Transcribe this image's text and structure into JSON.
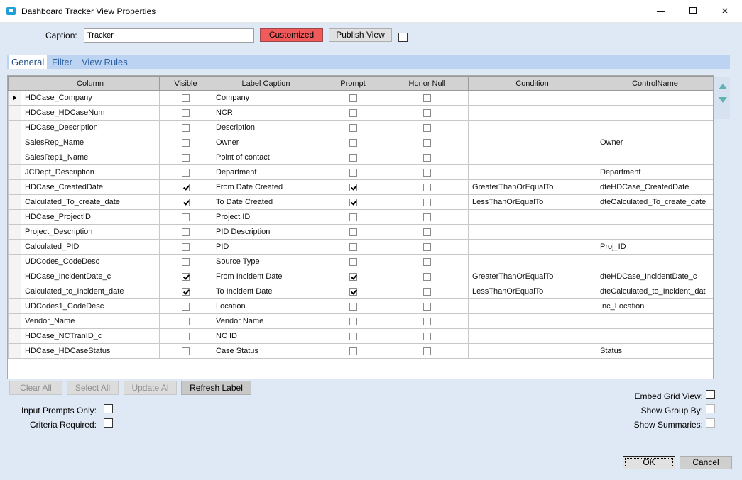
{
  "window": {
    "title": "Dashboard Tracker View Properties",
    "minimize_glyph": "",
    "close_glyph": "✕"
  },
  "caption": {
    "label": "Caption:",
    "value": "Tracker",
    "customized_label": "Customized",
    "publish_label": "Publish View",
    "checkbox_checked": false
  },
  "colors": {
    "customized_bg": "#f05a5a",
    "tab_strip": "#bcd4f2",
    "window_bg": "#dfe8f5",
    "scroll_arrow": "#5fb3b3"
  },
  "tabs": [
    {
      "label": "General",
      "active": true
    },
    {
      "label": "Filter",
      "active": false
    },
    {
      "label": "View Rules",
      "active": false
    }
  ],
  "grid": {
    "columns": [
      "Column",
      "Visible",
      "Label Caption",
      "Prompt",
      "Honor Null",
      "Condition",
      "ControlName"
    ],
    "current_row": 0,
    "rows": [
      {
        "column": "HDCase_Company",
        "visible": false,
        "label": "Company",
        "prompt": false,
        "honor_null": false,
        "condition": "",
        "control": ""
      },
      {
        "column": "HDCase_HDCaseNum",
        "visible": false,
        "label": "NCR",
        "prompt": false,
        "honor_null": false,
        "condition": "",
        "control": ""
      },
      {
        "column": "HDCase_Description",
        "visible": false,
        "label": "Description",
        "prompt": false,
        "honor_null": false,
        "condition": "",
        "control": ""
      },
      {
        "column": "SalesRep_Name",
        "visible": false,
        "label": "Owner",
        "prompt": false,
        "honor_null": false,
        "condition": "",
        "control": "Owner"
      },
      {
        "column": "SalesRep1_Name",
        "visible": false,
        "label": "Point of contact",
        "prompt": false,
        "honor_null": false,
        "condition": "",
        "control": ""
      },
      {
        "column": "JCDept_Description",
        "visible": false,
        "label": "Department",
        "prompt": false,
        "honor_null": false,
        "condition": "",
        "control": "Department"
      },
      {
        "column": "HDCase_CreatedDate",
        "visible": true,
        "label": "From Date Created",
        "prompt": true,
        "honor_null": false,
        "condition": "GreaterThanOrEqualTo",
        "control": "dteHDCase_CreatedDate"
      },
      {
        "column": "Calculated_To_create_date",
        "visible": true,
        "label": "To Date Created",
        "prompt": true,
        "honor_null": false,
        "condition": "LessThanOrEqualTo",
        "control": "dteCalculated_To_create_date"
      },
      {
        "column": "HDCase_ProjectID",
        "visible": false,
        "label": "Project ID",
        "prompt": false,
        "honor_null": false,
        "condition": "",
        "control": ""
      },
      {
        "column": "Project_Description",
        "visible": false,
        "label": "PID Description",
        "prompt": false,
        "honor_null": false,
        "condition": "",
        "control": ""
      },
      {
        "column": "Calculated_PID",
        "visible": false,
        "label": "PID",
        "prompt": false,
        "honor_null": false,
        "condition": "",
        "control": "Proj_ID"
      },
      {
        "column": "UDCodes_CodeDesc",
        "visible": false,
        "label": "Source Type",
        "prompt": false,
        "honor_null": false,
        "condition": "",
        "control": ""
      },
      {
        "column": "HDCase_IncidentDate_c",
        "visible": true,
        "label": "From Incident Date",
        "prompt": true,
        "honor_null": false,
        "condition": "GreaterThanOrEqualTo",
        "control": "dteHDCase_IncidentDate_c"
      },
      {
        "column": "Calculated_to_Incident_date",
        "visible": true,
        "label": "To Incident Date",
        "prompt": true,
        "honor_null": false,
        "condition": "LessThanOrEqualTo",
        "control": "dteCalculated_to_Incident_dat"
      },
      {
        "column": "UDCodes1_CodeDesc",
        "visible": false,
        "label": "Location",
        "prompt": false,
        "honor_null": false,
        "condition": "",
        "control": "Inc_Location"
      },
      {
        "column": "Vendor_Name",
        "visible": false,
        "label": "Vendor Name",
        "prompt": false,
        "honor_null": false,
        "condition": "",
        "control": ""
      },
      {
        "column": "HDCase_NCTranID_c",
        "visible": false,
        "label": "NC ID",
        "prompt": false,
        "honor_null": false,
        "condition": "",
        "control": ""
      },
      {
        "column": "HDCase_HDCaseStatus",
        "visible": false,
        "label": "Case Status",
        "prompt": false,
        "honor_null": false,
        "condition": "",
        "control": "Status"
      }
    ]
  },
  "grid_buttons": {
    "clear_all": "Clear All",
    "select_all": "Select All",
    "update_all": "Update Al",
    "refresh_label": "Refresh Label"
  },
  "options_left": {
    "input_prompts_only": {
      "label": "Input Prompts Only:",
      "checked": false
    },
    "criteria_required": {
      "label": "Criteria Required:",
      "checked": false
    }
  },
  "options_right": {
    "embed_grid_view": {
      "label": "Embed Grid View:",
      "checked": false
    },
    "show_group_by": {
      "label": "Show Group By:",
      "checked": false
    },
    "show_summaries": {
      "label": "Show Summaries:",
      "checked": false
    }
  },
  "footer": {
    "ok_label": "OK",
    "cancel_label": "Cancel"
  }
}
